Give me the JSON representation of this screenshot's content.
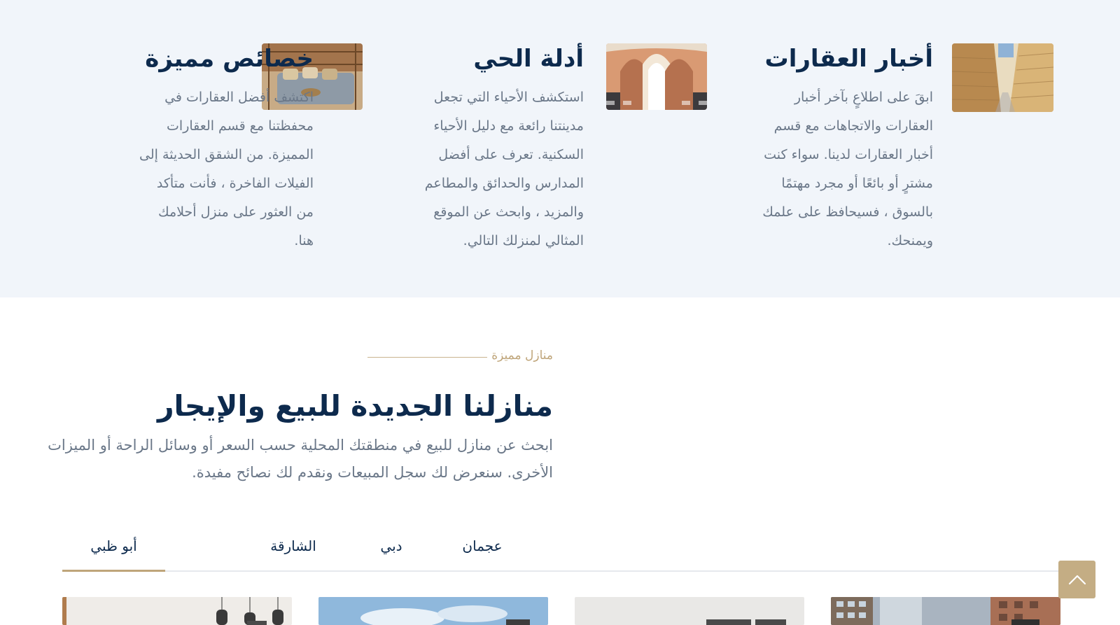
{
  "features": [
    {
      "title": "أخبار العقارات",
      "lines": [
        "ابقَ على اطلاعٍ بآخر أخبار",
        "العقارات والاتجاهات مع قسم",
        "أخبار العقارات لدينا. سواء كنت",
        "مشترٍ أو بائعًا أو مجرد مهتمًا",
        "بالسوق ، فسيحافظ على علمك",
        ".ويمنحك"
      ],
      "image": "alley-image"
    },
    {
      "title": "أدلة الحي",
      "lines": [
        "استكشف الأحياء التي تجعل",
        "مدينتنا رائعة مع دليل الأحياء",
        "السكنية. تعرف على أفضل",
        "المدارس والحدائق والمطاعم",
        "والمزيد ، وابحث عن الموقع",
        ".المثالي لمنزلك التالي"
      ],
      "image": "arches-image"
    },
    {
      "title": "خصائص مميزة",
      "lines": [
        "اكتشف أفضل العقارات في",
        "محفظتنا مع قسم العقارات",
        "المميزة. من الشقق الحديثة إلى",
        "الفيلات الفاخرة ، فأنت متأكد",
        "من العثور على منزل أحلامك",
        ".هنا"
      ],
      "image": "lounge-image"
    }
  ],
  "section": {
    "eyebrow": "منازل مميزة",
    "title": "منازلنا الجديدة للبيع والإيجار",
    "desc_lines": [
      "ابحث عن منازل للبيع في منطقتك المحلية حسب السعر أو وسائل الراحة أو الميزات",
      ".الأخرى. سنعرض لك سجل المبيعات ونقدم لك نصائح مفيدة"
    ]
  },
  "tabs": [
    {
      "label": "أبو ظبي",
      "active": true
    },
    {
      "label": "الشارقة",
      "active": false
    },
    {
      "label": "دبي",
      "active": false
    },
    {
      "label": "عجمان",
      "active": false
    }
  ],
  "colors": {
    "navy": "#0d2a4d",
    "gold": "#bfa57a",
    "band": "#f1f5fa",
    "body_text": "#6a7788"
  },
  "icons": {
    "scroll_top": "chevron-up-icon"
  }
}
